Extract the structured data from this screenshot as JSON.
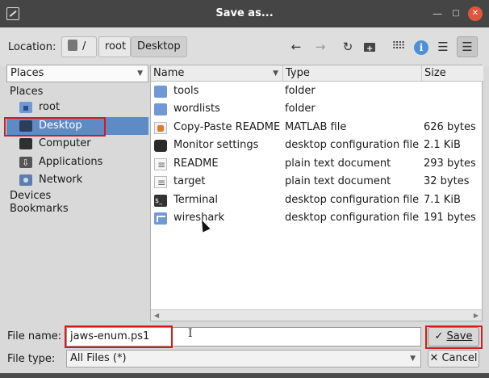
{
  "window": {
    "title": "Save as...",
    "minimize_glyph": "—",
    "maximize_glyph": "□",
    "close_glyph": "✕"
  },
  "location": {
    "label": "Location:",
    "crumbs": [
      "/",
      "root",
      "Desktop"
    ]
  },
  "toolbar": {
    "back_glyph": "←",
    "forward_glyph": "→",
    "reload_glyph": "↻",
    "grid_glyph": "⠿⠿",
    "info_glyph": "i",
    "list_glyph": "☰",
    "detail_glyph": "☰"
  },
  "places": {
    "select_value": "Places",
    "heading": "Places",
    "items": [
      {
        "label": "root",
        "icon": "home-folder-icon"
      },
      {
        "label": "Desktop",
        "icon": "desktop-icon",
        "selected": true
      },
      {
        "label": "Computer",
        "icon": "computer-icon"
      },
      {
        "label": "Applications",
        "icon": "applications-icon"
      },
      {
        "label": "Network",
        "icon": "network-icon"
      }
    ],
    "devices": "Devices",
    "bookmarks": "Bookmarks"
  },
  "files": {
    "columns": {
      "name": "Name",
      "type": "Type",
      "size": "Size"
    },
    "rows": [
      {
        "name": "tools",
        "type": "folder",
        "size": "",
        "icon": "folder-icon"
      },
      {
        "name": "wordlists",
        "type": "folder",
        "size": "",
        "icon": "folder-icon"
      },
      {
        "name": "Copy-Paste README",
        "type": "MATLAB file",
        "size": "626 bytes",
        "icon": "matlab-file-icon"
      },
      {
        "name": "Monitor settings",
        "type": "desktop configuration file",
        "size": "2.1  KiB",
        "icon": "monitor-icon"
      },
      {
        "name": "README",
        "type": "plain text document",
        "size": "293 bytes",
        "icon": "text-file-icon"
      },
      {
        "name": "target",
        "type": "plain text document",
        "size": "32 bytes",
        "icon": "text-file-icon"
      },
      {
        "name": "Terminal",
        "type": "desktop configuration file",
        "size": "7.1  KiB",
        "icon": "terminal-icon"
      },
      {
        "name": "wireshark",
        "type": "desktop configuration file",
        "size": "191 bytes",
        "icon": "wireshark-icon"
      }
    ]
  },
  "footer": {
    "filename_label": "File name:",
    "filename_value": "jaws-enum.ps1",
    "filetype_label": "File type:",
    "filetype_value": "All Files (*)",
    "save_label": "Save",
    "cancel_label": "Cancel"
  },
  "colors": {
    "selection": "#5e8ac6",
    "highlight_outline": "#d21c1c",
    "titlebar": "#454545"
  }
}
